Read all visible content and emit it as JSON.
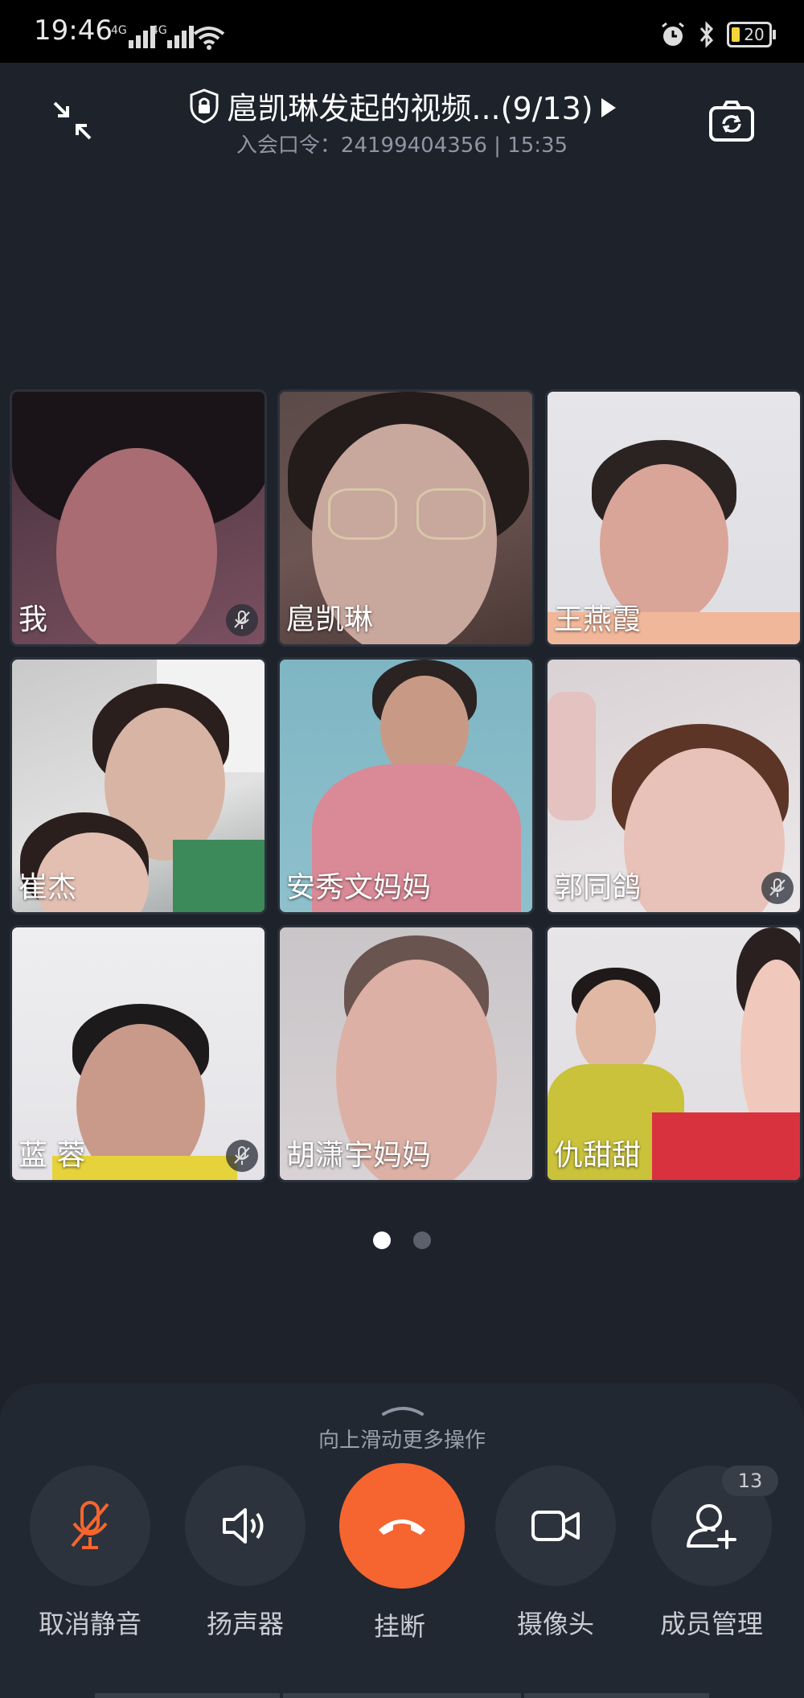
{
  "status_bar": {
    "time": "19:46",
    "network_1": "4G",
    "network_2": "4G",
    "battery_level": "20"
  },
  "header": {
    "title": "扈凯琳发起的视频...(9/13)",
    "subtitle": "入会口令：24199404356 | 15:35"
  },
  "participants": [
    {
      "name": "我",
      "muted": true
    },
    {
      "name": "扈凯琳",
      "muted": false
    },
    {
      "name": "王燕霞",
      "muted": false
    },
    {
      "name": "崔杰",
      "muted": false
    },
    {
      "name": "安秀文妈妈",
      "muted": false
    },
    {
      "name": "郭同鸽",
      "muted": true
    },
    {
      "name": "蓝  蓉",
      "muted": true
    },
    {
      "name": "胡潇宇妈妈",
      "muted": false
    },
    {
      "name": "仇甜甜",
      "muted": false
    }
  ],
  "pagination": {
    "current": 1,
    "total": 2
  },
  "panel": {
    "hint": "向上滑动更多操作",
    "controls": {
      "unmute": "取消静音",
      "speaker": "扬声器",
      "hangup": "挂断",
      "camera": "摄像头",
      "members": "成员管理"
    },
    "members_count": "13"
  },
  "colors": {
    "background": "#1d222b",
    "panel": "#222832",
    "hangup": "#f6652f",
    "mute_accent": "#f6652f"
  }
}
